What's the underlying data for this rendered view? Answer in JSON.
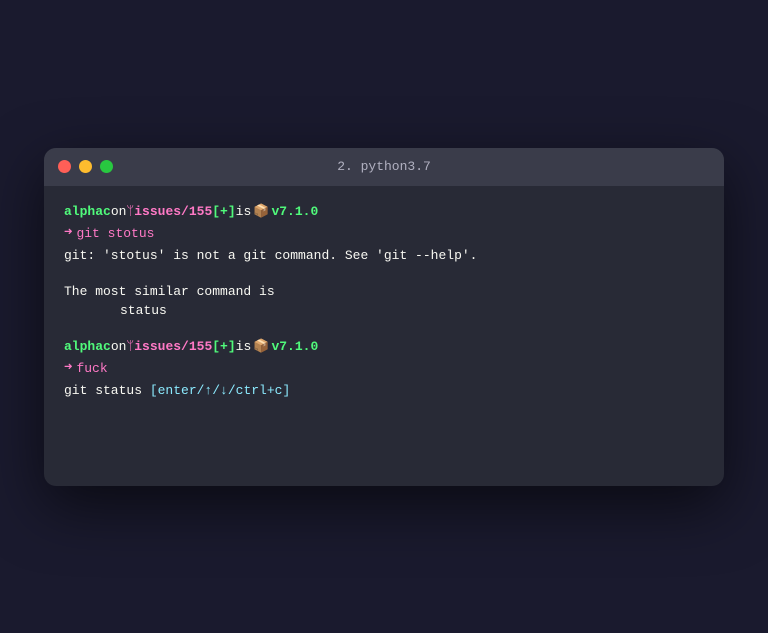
{
  "window": {
    "title": "2. python3.7",
    "traffic_lights": [
      "red",
      "yellow",
      "green"
    ]
  },
  "terminal": {
    "block1": {
      "prompt": {
        "username": "alphac",
        "on": " on ",
        "branch_icon": "ᛘ",
        "branch": " issues/155",
        "plus": " [+]",
        "is": " is ",
        "pkg_emoji": "📦",
        "version": " v7.1.0"
      },
      "command": {
        "arrow": "➜",
        "text": "git stotus"
      },
      "output_line1": "git: 'stotus' is not a git command. See 'git --help'.",
      "blank": "",
      "output_line2": "The most similar command is",
      "output_line3": "        status"
    },
    "block2": {
      "prompt": {
        "username": "alphac",
        "on": " on ",
        "branch_icon": "ᛘ",
        "branch": " issues/155",
        "plus": " [+]",
        "is": " is ",
        "pkg_emoji": "📦",
        "version": " v7.1.0"
      },
      "command": {
        "arrow": "➜",
        "text": "fuck"
      },
      "suggestion": {
        "cmd": "git status",
        "hint": "[enter/↑/↓/ctrl+c]"
      }
    }
  }
}
